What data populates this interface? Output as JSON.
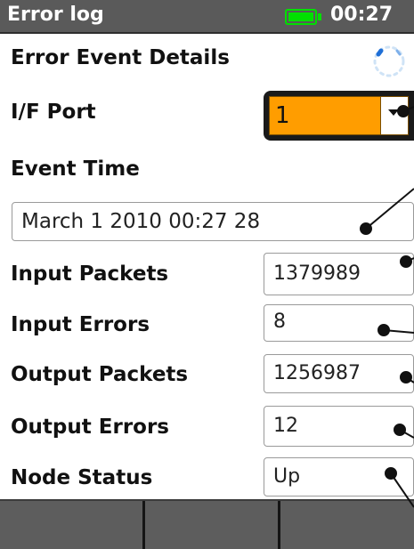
{
  "header": {
    "title": "Error log",
    "time": "00:27",
    "battery_color": "#00e000"
  },
  "page": {
    "heading": "Error Event Details"
  },
  "if_port": {
    "label": "I/F Port",
    "value": "1",
    "highlight_color": "#ff9d00"
  },
  "event_time": {
    "label": "Event Time",
    "value": "March 1 2010 00:27 28"
  },
  "stats": [
    {
      "label": "Input Packets",
      "value": "1379989"
    },
    {
      "label": "Input Errors",
      "value": "8"
    },
    {
      "label": "Output Packets",
      "value": "1256987"
    },
    {
      "label": "Output Errors",
      "value": "12"
    },
    {
      "label": "Node Status",
      "value": "Up"
    }
  ],
  "softkeys": [
    {
      "label": ""
    },
    {
      "label": ""
    },
    {
      "label": ""
    }
  ],
  "icons": {
    "battery": "battery-icon",
    "spinner": "loading-spinner-icon",
    "dropdown": "chevron-down-icon",
    "callout": "callout-pointer-icon"
  }
}
